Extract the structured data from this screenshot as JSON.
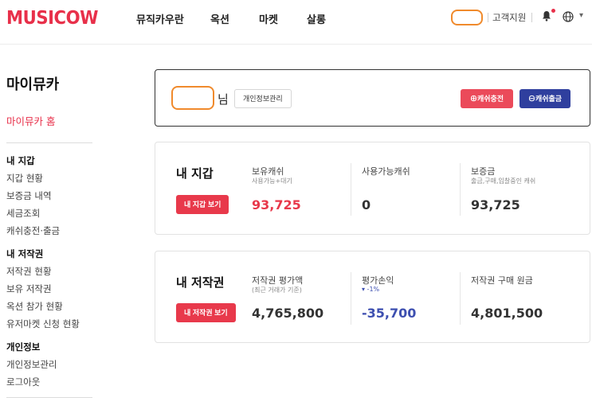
{
  "header": {
    "logo": "MUSICOW",
    "nav": [
      "뮤직카우란",
      "옥션",
      "마켓",
      "살롱"
    ],
    "support": "고객지원",
    "icons": [
      "bell-icon",
      "globe-icon",
      "chevron-down-icon"
    ],
    "accent": "#e8304a"
  },
  "sidebar": {
    "title": "마이뮤카",
    "home": "마이뮤카 홈",
    "groups": [
      {
        "title": "내 지갑",
        "items": [
          "지갑 현황",
          "보증금 내역",
          "세금조회",
          "캐쉬충전·출금"
        ]
      },
      {
        "title": "내 저작권",
        "items": [
          "저작권 현황",
          "보유 저작권",
          "옥션 참가 현황",
          "유저마켓 신청 현황"
        ]
      },
      {
        "title": "개인정보",
        "items": [
          "개인정보관리",
          "로그아웃"
        ]
      }
    ]
  },
  "user_card": {
    "suffix": "님",
    "profile_button": "개인정보관리",
    "charge_button": "⊕캐쉬충전",
    "withdraw_button": "⊖캐쉬출금"
  },
  "wallet": {
    "title": "내 지갑",
    "button": "내 지갑 보기",
    "cols": [
      {
        "label": "보유캐쉬",
        "sub": "사용가능+대기",
        "value": "93,725"
      },
      {
        "label": "사용가능캐쉬",
        "sub": "",
        "value": "0"
      },
      {
        "label": "보증금",
        "sub": "출금,구매,입찰중인 캐쉬",
        "value": "93,725"
      }
    ]
  },
  "copyright": {
    "title": "내 저작권",
    "button": "내 저작권 보기",
    "cols": [
      {
        "label": "저작권 평가액",
        "sub": "(최근 거래가 기준)",
        "value": "4,765,800"
      },
      {
        "label": "평가손익",
        "sub": "▾ -1%",
        "value": "-35,700"
      },
      {
        "label": "저작권 구매 원금",
        "sub": "",
        "value": "4,801,500"
      }
    ]
  },
  "colors": {
    "red_value": "#e8394b",
    "blue_value": "#2f3f9e",
    "neg_value": "#3d4fb0"
  }
}
